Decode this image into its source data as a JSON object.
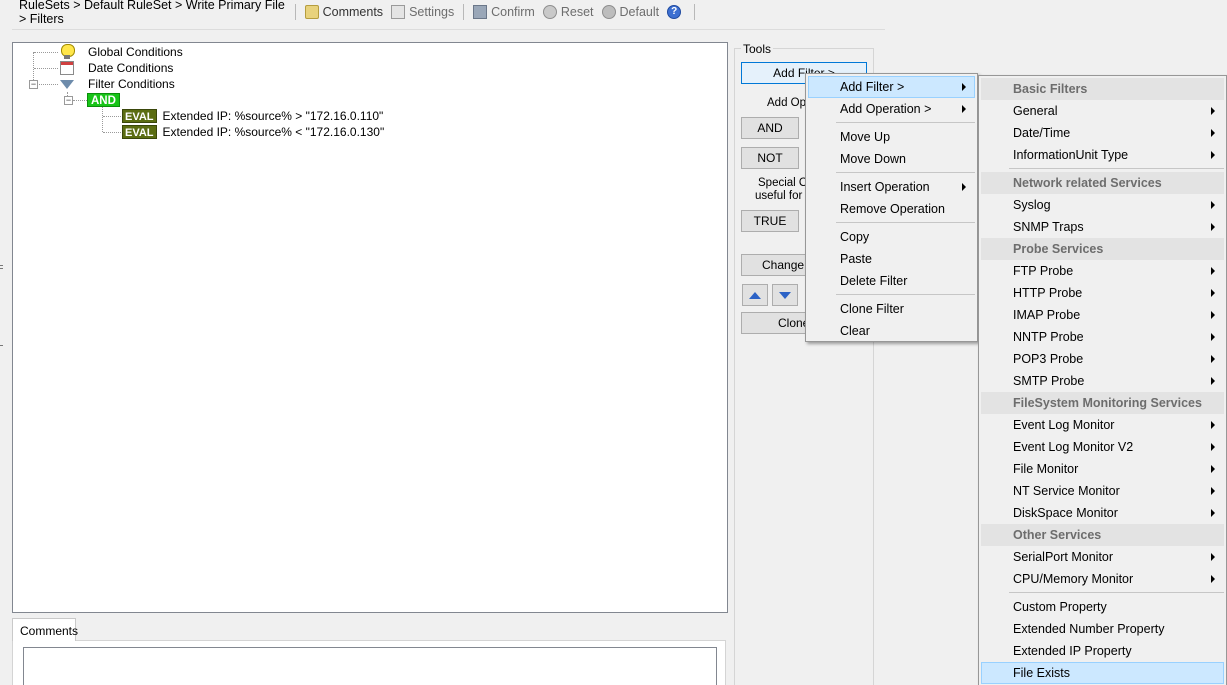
{
  "toolbar": {
    "breadcrumb": "RuleSets > Default RuleSet > Write Primary File > Filters",
    "comments": "Comments",
    "settings": "Settings",
    "confirm": "Confirm",
    "reset": "Reset",
    "default": "Default",
    "help_glyph": "?"
  },
  "tree": {
    "global_conditions": "Global Conditions",
    "date_conditions": "Date Conditions",
    "filter_conditions": "Filter Conditions",
    "and_label": "AND",
    "eval_badge": "EVAL",
    "eval_1": "Extended IP: %source% >  \"172.16.0.110\"",
    "eval_2": "Extended IP: %source% < \"172.16.0.130\"",
    "expander_minus": "−",
    "icons": [
      "bulb-icon",
      "calendar-icon",
      "funnel-icon"
    ]
  },
  "comments": {
    "tab_label": "Comments",
    "value": ""
  },
  "tools": {
    "legend": "Tools",
    "add_filter": "Add Filter >",
    "add_operation_label": "Add Ope",
    "and_button": "AND",
    "not_button": "NOT",
    "special_label_1": "Special O",
    "special_label_2": "useful for c",
    "true_button": "TRUE",
    "change_button": "Change (",
    "clone_button": "Clone"
  },
  "context_menu": {
    "items": {
      "add_filter": "Add Filter >",
      "add_operation": "Add Operation >",
      "move_up": "Move Up",
      "move_down": "Move Down",
      "insert_operation": "Insert Operation",
      "remove_operation": "Remove Operation",
      "copy": "Copy",
      "paste": "Paste",
      "delete_filter": "Delete Filter",
      "clone_filter": "Clone Filter",
      "clear": "Clear"
    }
  },
  "filter_submenu": {
    "basic_header": "Basic Filters",
    "general": "General",
    "date_time": "Date/Time",
    "information_unit_type": "InformationUnit Type",
    "network_header": "Network related Services",
    "syslog": "Syslog",
    "snmp_traps": "SNMP Traps",
    "probe_header": "Probe Services",
    "ftp_probe": "FTP Probe",
    "http_probe": "HTTP Probe",
    "imap_probe": "IMAP Probe",
    "nntp_probe": "NNTP Probe",
    "pop3_probe": "POP3 Probe",
    "smtp_probe": "SMTP Probe",
    "filesystem_header": "FileSystem Monitoring Services",
    "event_log_monitor": "Event Log Monitor",
    "event_log_monitor_v2": "Event Log Monitor V2",
    "file_monitor": "File Monitor",
    "nt_service_monitor": "NT Service Monitor",
    "diskspace_monitor": "DiskSpace Monitor",
    "other_header": "Other Services",
    "serialport_monitor": "SerialPort Monitor",
    "cpu_memory_monitor": "CPU/Memory Monitor",
    "custom_property": "Custom Property",
    "extended_number_property": "Extended Number Property",
    "extended_ip_property": "Extended IP Property",
    "file_exists": "File Exists"
  },
  "colors": {
    "and_badge": "#17c417",
    "eval_badge": "#5b6d12",
    "menu_highlight": "#cce8ff",
    "menu_highlight_border": "#99d1ff",
    "help_icon": "#3c6fd1"
  }
}
